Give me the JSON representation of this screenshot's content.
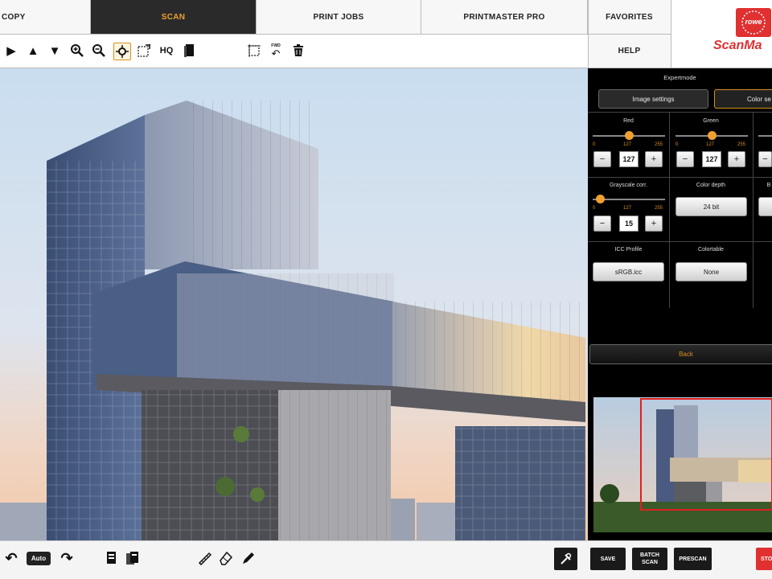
{
  "tabs": [
    {
      "label": "COPY"
    },
    {
      "label": "SCAN"
    },
    {
      "label": "PRINT JOBS"
    },
    {
      "label": "PRINTMASTER PRO"
    }
  ],
  "favorites_label": "FAVORITES",
  "help_label": "HELP",
  "brand": {
    "badge_text": "rowe",
    "name": "ScanMa",
    "accent": "#e03030"
  },
  "toolbar": {
    "hq_label": "HQ",
    "fwd_label": "FWD"
  },
  "expert": {
    "title": "Expertmode",
    "image_settings_label": "Image settings",
    "color_settings_label": "Color se",
    "red": {
      "label": "Red",
      "min": "0",
      "mid": "127",
      "max": "255",
      "value": "127"
    },
    "green": {
      "label": "Green",
      "min": "0",
      "mid": "127",
      "max": "255",
      "value": "127"
    },
    "grayscale": {
      "label": "Grayscale corr.",
      "min": "0",
      "mid": "127",
      "max": "255",
      "value": "15"
    },
    "color_depth": {
      "label": "Color depth",
      "value": "24 bit"
    },
    "col3_label": "B",
    "icc": {
      "label": "ICC Profile",
      "value": "sRGB.icc"
    },
    "colortable": {
      "label": "Colortable",
      "value": "None"
    },
    "back_label": "Back"
  },
  "bottom": {
    "auto_label": "Auto",
    "save_label": "SAVE",
    "batch_label_1": "BATCH",
    "batch_label_2": "SCAN",
    "prescan_label": "PRESCAN",
    "stop_label": "STO"
  },
  "colors": {
    "accent": "#f0a030",
    "active_tab_bg": "#2a2a2a",
    "stop": "#e03030"
  }
}
